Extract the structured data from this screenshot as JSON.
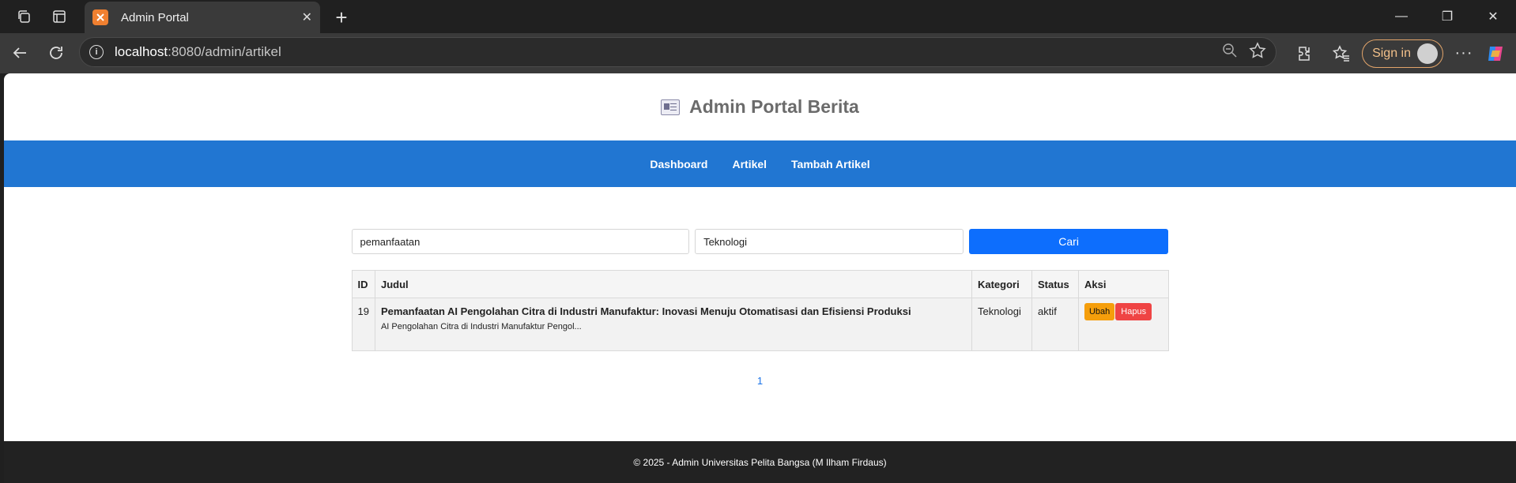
{
  "browser": {
    "tab_title": "Admin Portal",
    "url_host": "localhost",
    "url_path": ":8080/admin/artikel",
    "signin_label": "Sign in"
  },
  "site": {
    "title": "Admin Portal Berita"
  },
  "nav": {
    "items": [
      {
        "label": "Dashboard"
      },
      {
        "label": "Artikel"
      },
      {
        "label": "Tambah Artikel"
      }
    ]
  },
  "search": {
    "query_value": "pemanfaatan",
    "category_value": "Teknologi",
    "button_label": "Cari"
  },
  "table": {
    "headers": {
      "id": "ID",
      "judul": "Judul",
      "kategori": "Kategori",
      "status": "Status",
      "aksi": "Aksi"
    },
    "rows": [
      {
        "id": "19",
        "judul": "Pemanfaatan AI Pengolahan Citra di Industri Manufaktur: Inovasi Menuju Otomatisasi dan Efisiensi Produksi",
        "excerpt": "AI Pengolahan Citra di Industri Manufaktur Pengol...",
        "kategori": "Teknologi",
        "status": "aktif",
        "edit_label": "Ubah",
        "delete_label": "Hapus"
      }
    ]
  },
  "pagination": {
    "current_page": "1"
  },
  "footer": {
    "text": "© 2025 - Admin Universitas Pelita Bangsa (M Ilham Firdaus)"
  },
  "colors": {
    "nav_bg": "#2176d2",
    "search_button": "#0d6efd",
    "edit_button": "#f59e0b",
    "delete_button": "#ef4444",
    "footer_bg": "#222222"
  }
}
